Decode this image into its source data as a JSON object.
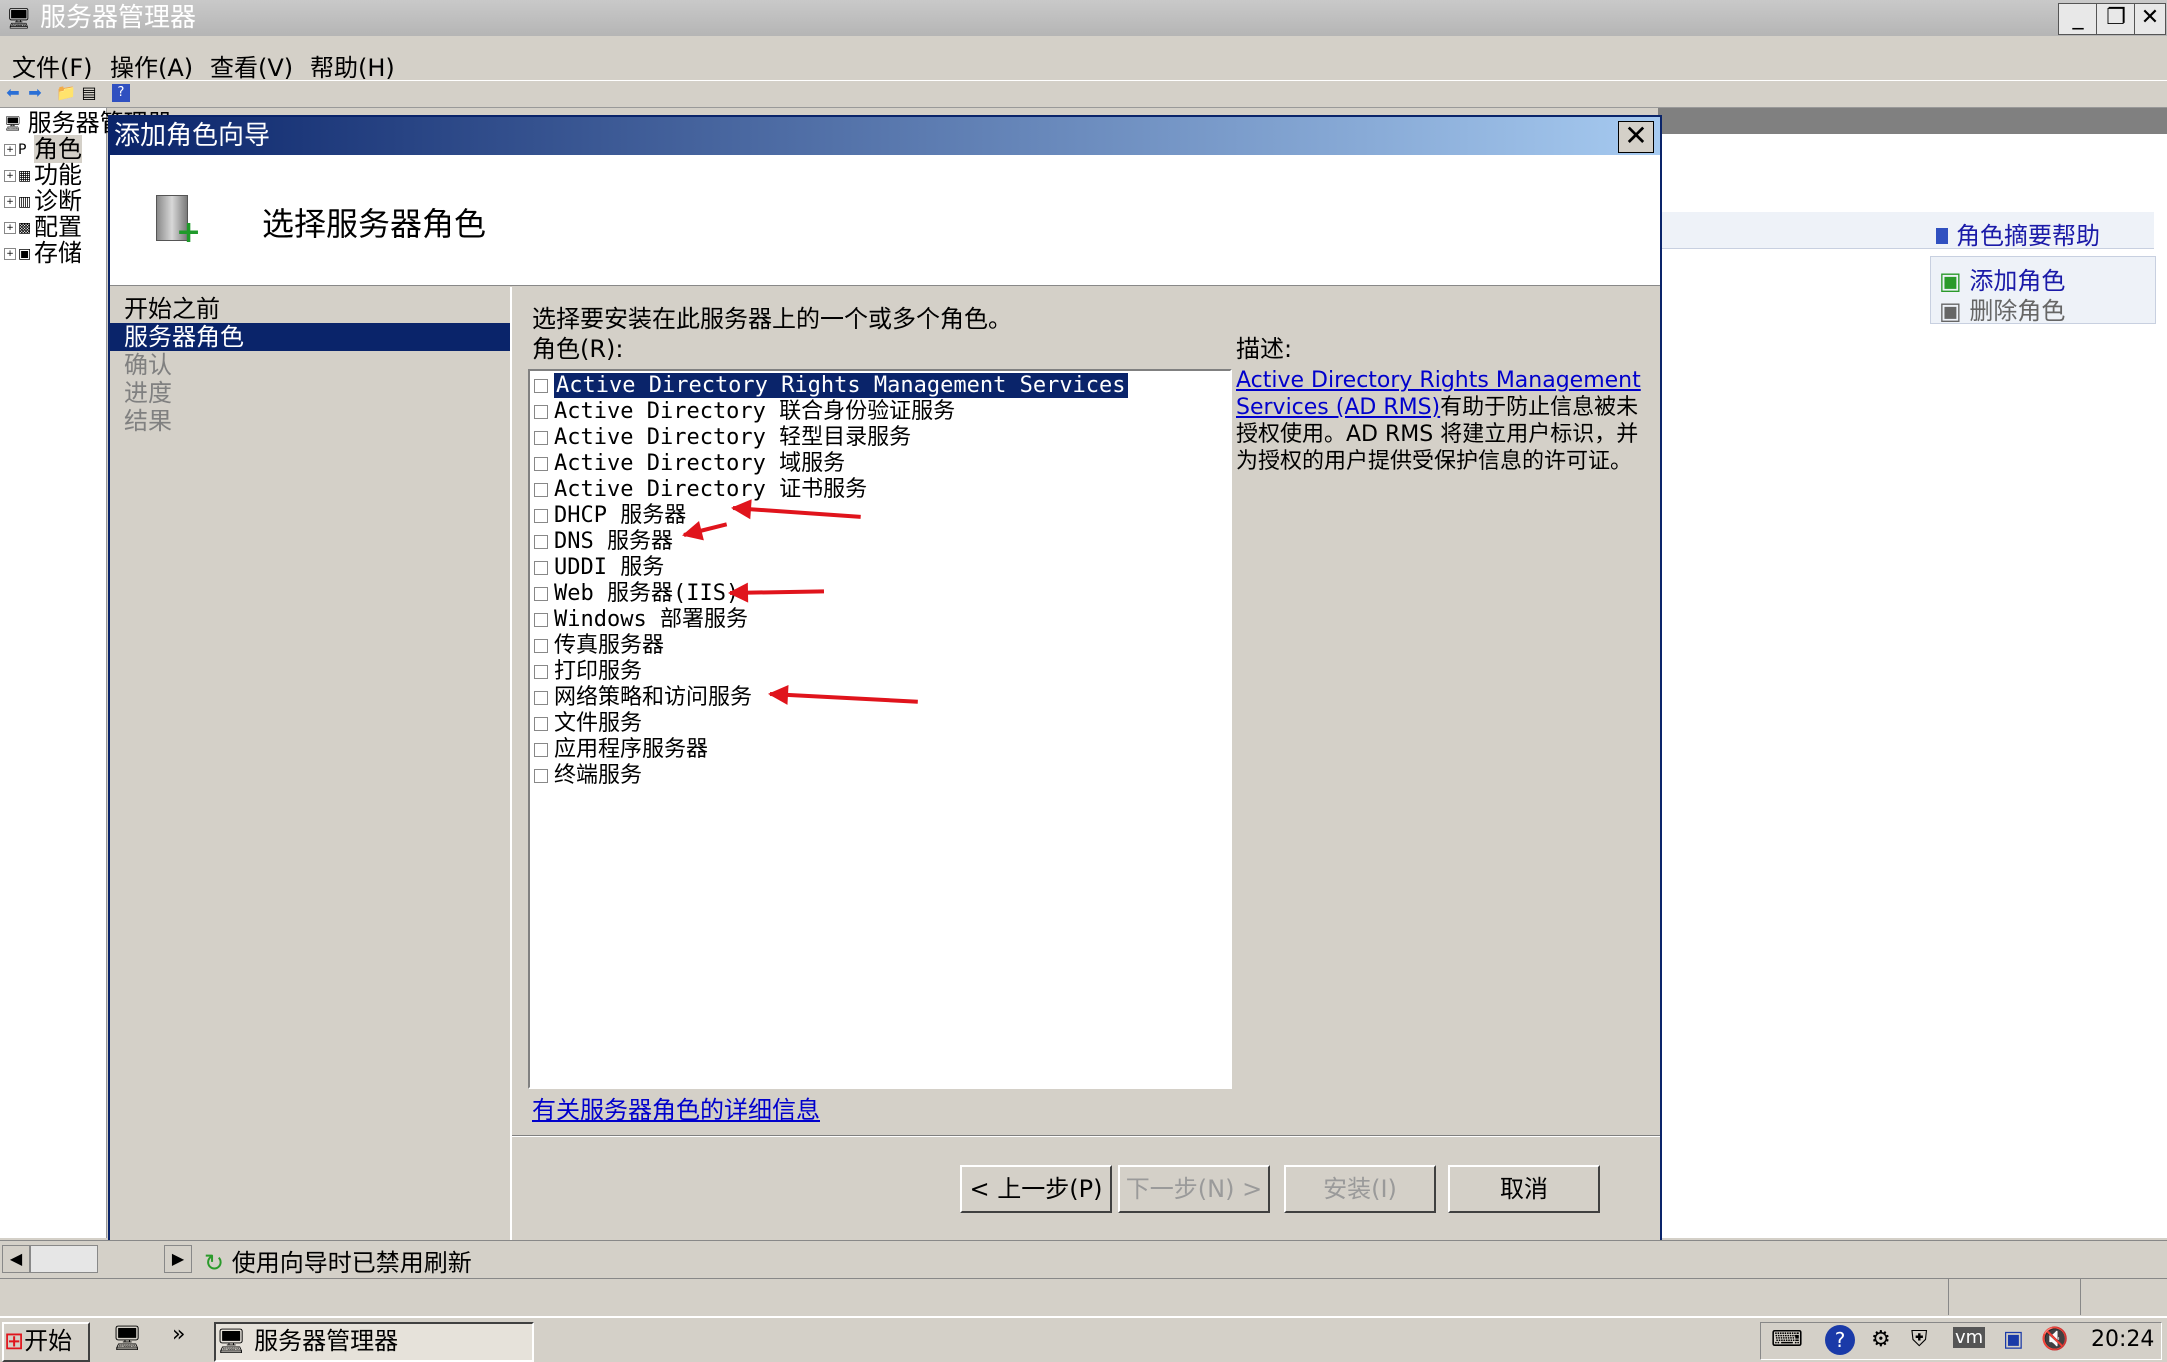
{
  "window": {
    "title": "服务器管理器"
  },
  "menu": [
    "文件(F)",
    "操作(A)",
    "查看(V)",
    "帮助(H)"
  ],
  "tree": [
    {
      "label": "服务器管理器",
      "icon": "server-icon"
    },
    {
      "label": "角色",
      "icon": "roles-icon"
    },
    {
      "label": "功能",
      "icon": "features-icon"
    },
    {
      "label": "诊断",
      "icon": "diagnostics-icon"
    },
    {
      "label": "配置",
      "icon": "configuration-icon"
    },
    {
      "label": "存储",
      "icon": "storage-icon"
    }
  ],
  "actions": {
    "header": "角色摘要帮助",
    "items": [
      "添加角色",
      "删除角色"
    ]
  },
  "dialog": {
    "title": "添加角色向导",
    "heading": "选择服务器角色",
    "nav": [
      {
        "label": "开始之前",
        "state": "normal"
      },
      {
        "label": "服务器角色",
        "state": "selected"
      },
      {
        "label": "确认",
        "state": "disabled"
      },
      {
        "label": "进度",
        "state": "disabled"
      },
      {
        "label": "结果",
        "state": "disabled"
      }
    ],
    "instruction": "选择要安装在此服务器上的一个或多个角色。",
    "roles_label": "角色(R):",
    "roles": [
      {
        "label": "Active Directory Rights Management Services",
        "checked": false,
        "selected": true
      },
      {
        "label": "Active Directory 联合身份验证服务",
        "checked": false
      },
      {
        "label": "Active Directory 轻型目录服务",
        "checked": false
      },
      {
        "label": "Active Directory 域服务",
        "checked": false
      },
      {
        "label": "Active Directory 证书服务",
        "checked": false
      },
      {
        "label": "DHCP 服务器",
        "checked": false,
        "annotated": true
      },
      {
        "label": "DNS 服务器",
        "checked": false,
        "annotated": true
      },
      {
        "label": "UDDI 服务",
        "checked": false
      },
      {
        "label": "Web 服务器(IIS)",
        "checked": false,
        "annotated": true
      },
      {
        "label": "Windows 部署服务",
        "checked": false
      },
      {
        "label": "传真服务器",
        "checked": false
      },
      {
        "label": "打印服务",
        "checked": false
      },
      {
        "label": "网络策略和访问服务",
        "checked": false,
        "annotated": true
      },
      {
        "label": "文件服务",
        "checked": false
      },
      {
        "label": "应用程序服务器",
        "checked": false
      },
      {
        "label": "终端服务",
        "checked": false
      }
    ],
    "description_label": "描述:",
    "description_link": "Active Directory Rights Management Services (AD RMS)",
    "description_text": "有助于防止信息被未授权使用。AD RMS 将建立用户标识，并为授权的用户提供受保护信息的许可证。",
    "more_info_link": "有关服务器角色的详细信息",
    "buttons": {
      "back": "< 上一步(P)",
      "next": "下一步(N) >",
      "install": "安装(I)",
      "cancel": "取消"
    },
    "annotation_color": "#e0141c"
  },
  "status": {
    "text": "使用向导时已禁用刷新"
  },
  "taskbar": {
    "start": "开始",
    "task": "服务器管理器",
    "clock": "20:24"
  },
  "colors": {
    "selection": "#0a246a",
    "link": "#0000cc"
  }
}
